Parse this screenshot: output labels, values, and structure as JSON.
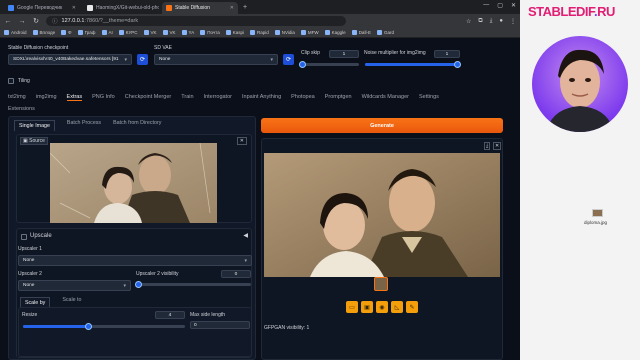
{
  "browser": {
    "tabs": [
      {
        "label": "Google Переводчик",
        "color": "#4285f4",
        "active": false
      },
      {
        "label": "HaomingX/Git-webui-old-pho",
        "color": "#e8e8e8",
        "active": false
      },
      {
        "label": "Stable Diffusion",
        "color": "#f97316",
        "active": true
      }
    ],
    "url_host": "127.0.0.1",
    "url_path": ":7860/?__theme=dark",
    "bookmarks": [
      "Android",
      "Вплоде",
      "Ф",
      "Граф",
      "AI",
      "КУРС",
      "VK",
      "VK",
      "YA",
      "Почта",
      "Kaspi",
      "Rapid",
      "NVidia",
      "MFW",
      "Kaggle",
      "Dall-E",
      "Gard"
    ]
  },
  "settings": {
    "checkpoint_label": "Stable Diffusion checkpoint",
    "checkpoint_value": "SDXL\\realvisxlV40_v40Bakedvae.safetensors [91",
    "vae_label": "SD VAE",
    "vae_value": "None",
    "clip_skip_label": "Clip skip",
    "clip_skip_value": "1",
    "clip_skip_level": 0.0,
    "noise_label": "Noise multiplier for img2img",
    "noise_value": "1",
    "noise_level": 1.0,
    "tiling_label": "Tiling"
  },
  "main_tabs": [
    "txt2img",
    "img2img",
    "Extras",
    "PNG Info",
    "Checkpoint Merger",
    "Train",
    "Interrogator",
    "Inpaint Anything",
    "Photopea",
    "Promptgen",
    "Wildcards Manager",
    "Settings"
  ],
  "main_tabs_row2": [
    "Extensions"
  ],
  "active_main_tab": "Extras",
  "extras": {
    "subtabs": [
      "Single Image",
      "Batch Process",
      "Batch from Directory"
    ],
    "source_label": "Source",
    "upscale_title": "Upscale",
    "upscaler1_label": "Upscaler 1",
    "upscaler1_value": "None",
    "upscaler2_label": "Upscaler 2",
    "upscaler2_value": "None",
    "upscaler2_vis_label": "Upscaler 2 visibility",
    "upscaler2_vis_value": "0",
    "upscaler2_vis_level": 0.0,
    "scale_tabs": [
      "Scale by",
      "Scale to"
    ],
    "resize_label": "Resize",
    "resize_value": "4",
    "resize_level": 0.4,
    "max_side_label": "Max side length",
    "max_side_value": "0"
  },
  "output": {
    "generate_label": "Generate",
    "gfpgan_label": "GFPGAN visibility: 1",
    "tools": [
      "folder-icon",
      "image-icon",
      "palette-icon",
      "ruler-icon",
      "brush-icon"
    ]
  },
  "sidebar": {
    "brand_main": "STABLEDIF",
    "brand_dot": ".",
    "brand_tld": "RU",
    "file_label": "diploma.jpg"
  },
  "colors": {
    "accent": "#f97316",
    "brand": "#e11d74",
    "slider": "#2563eb"
  }
}
